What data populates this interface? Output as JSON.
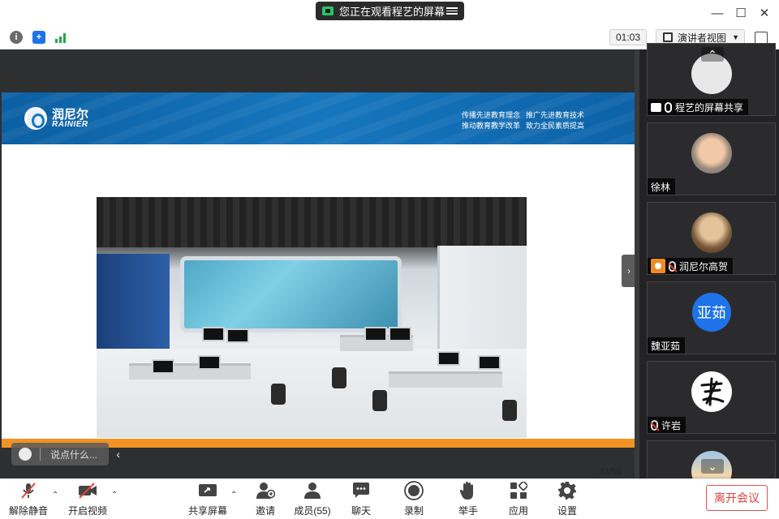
{
  "titlebar": {
    "share_notice": "您正在观看程艺的屏幕"
  },
  "topbar": {
    "timer": "01:03",
    "view_mode": "演讲者视图"
  },
  "slide": {
    "logo_cn": "润尼尔",
    "logo_en": "RAINIER",
    "slogan_1a": "传播先进教育理念",
    "slogan_1b": "推动教育教学改革",
    "slogan_2a": "推广先进教育技术",
    "slogan_2b": "致力全民素质提高",
    "page": "42/56"
  },
  "chat": {
    "placeholder": "说点什么..."
  },
  "participants": [
    {
      "name": "程艺的屏幕共享",
      "state": "sharing"
    },
    {
      "name": "徐林",
      "state": "none"
    },
    {
      "name": "润尼尔高贺",
      "state": "host-muted"
    },
    {
      "name": "魏亚茹",
      "avatar_text": "亚茹",
      "state": "none"
    },
    {
      "name": "许岩",
      "state": "muted"
    }
  ],
  "bottombar": {
    "unmute": "解除静音",
    "start_video": "开启视频",
    "share_screen": "共享屏幕",
    "invite": "邀请",
    "members": "成员(55)",
    "chat": "聊天",
    "record": "录制",
    "raise_hand": "举手",
    "apps": "应用",
    "settings": "设置",
    "leave": "离开会议"
  },
  "colors": {
    "accent_orange": "#f39222",
    "banner_blue": "#1676bd",
    "leave_red": "#e04040",
    "avatar_blue": "#1e73e8"
  }
}
